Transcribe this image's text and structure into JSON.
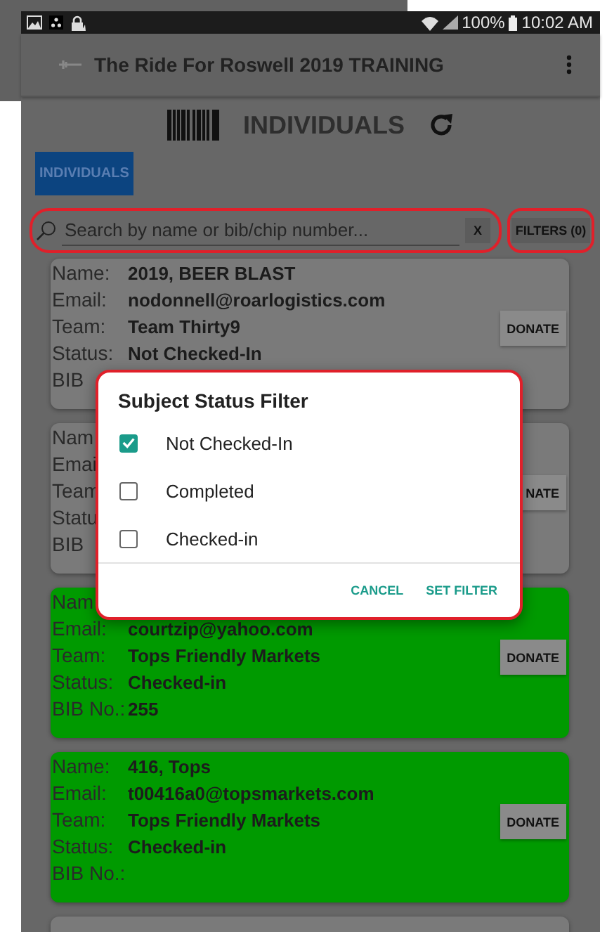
{
  "status_bar": {
    "battery": "100%",
    "time": "10:02 AM"
  },
  "app_bar": {
    "title": "The Ride For Roswell 2019 TRAINING"
  },
  "header": {
    "title": "INDIVIDUALS"
  },
  "tabs": [
    {
      "label": "INDIVIDUALS",
      "selected": true
    }
  ],
  "search": {
    "placeholder": "Search by name or bib/chip number...",
    "clear": "X",
    "filters": "FILTERS (0)"
  },
  "cards": [
    {
      "checked_in": false,
      "fields": [
        {
          "label": "Name:",
          "value": "2019, BEER BLAST"
        },
        {
          "label": "Email:",
          "value": "nodonnell@roarlogistics.com"
        },
        {
          "label": "Team:",
          "value": "Team Thirty9"
        },
        {
          "label": "Status:",
          "value": "Not Checked-In"
        },
        {
          "label": "BIB"
        }
      ],
      "button": "DONATE"
    },
    {
      "checked_in": false,
      "fields": [
        {
          "label": "Nam"
        },
        {
          "label": "Emai"
        },
        {
          "label": "Team"
        },
        {
          "label": "Statu"
        },
        {
          "label": "BIB"
        }
      ],
      "button": "NATE"
    },
    {
      "checked_in": true,
      "fields": [
        {
          "label": "Nam"
        },
        {
          "label": "Email:",
          "value": "courtzip@yahoo.com"
        },
        {
          "label": "Team:",
          "value": "Tops Friendly Markets"
        },
        {
          "label": "Status:",
          "value": "Checked-in"
        },
        {
          "label": "BIB No.:",
          "value": "255"
        }
      ],
      "button": "DONATE"
    },
    {
      "checked_in": true,
      "fields": [
        {
          "label": "Name:",
          "value": "416, Tops"
        },
        {
          "label": "Email:",
          "value": "t00416a0@topsmarkets.com"
        },
        {
          "label": "Team:",
          "value": "Tops Friendly Markets"
        },
        {
          "label": "Status:",
          "value": "Checked-in"
        },
        {
          "label": "BIB No.:"
        }
      ],
      "button": "DONATE"
    },
    {
      "checked_in": false
    }
  ],
  "dialog": {
    "title": "Subject Status Filter",
    "options": [
      {
        "label": "Not Checked-In",
        "checked": true
      },
      {
        "label": "Completed",
        "checked": false
      },
      {
        "label": "Checked-in",
        "checked": false
      }
    ],
    "buttons": [
      "CANCEL",
      "SET FILTER"
    ]
  }
}
